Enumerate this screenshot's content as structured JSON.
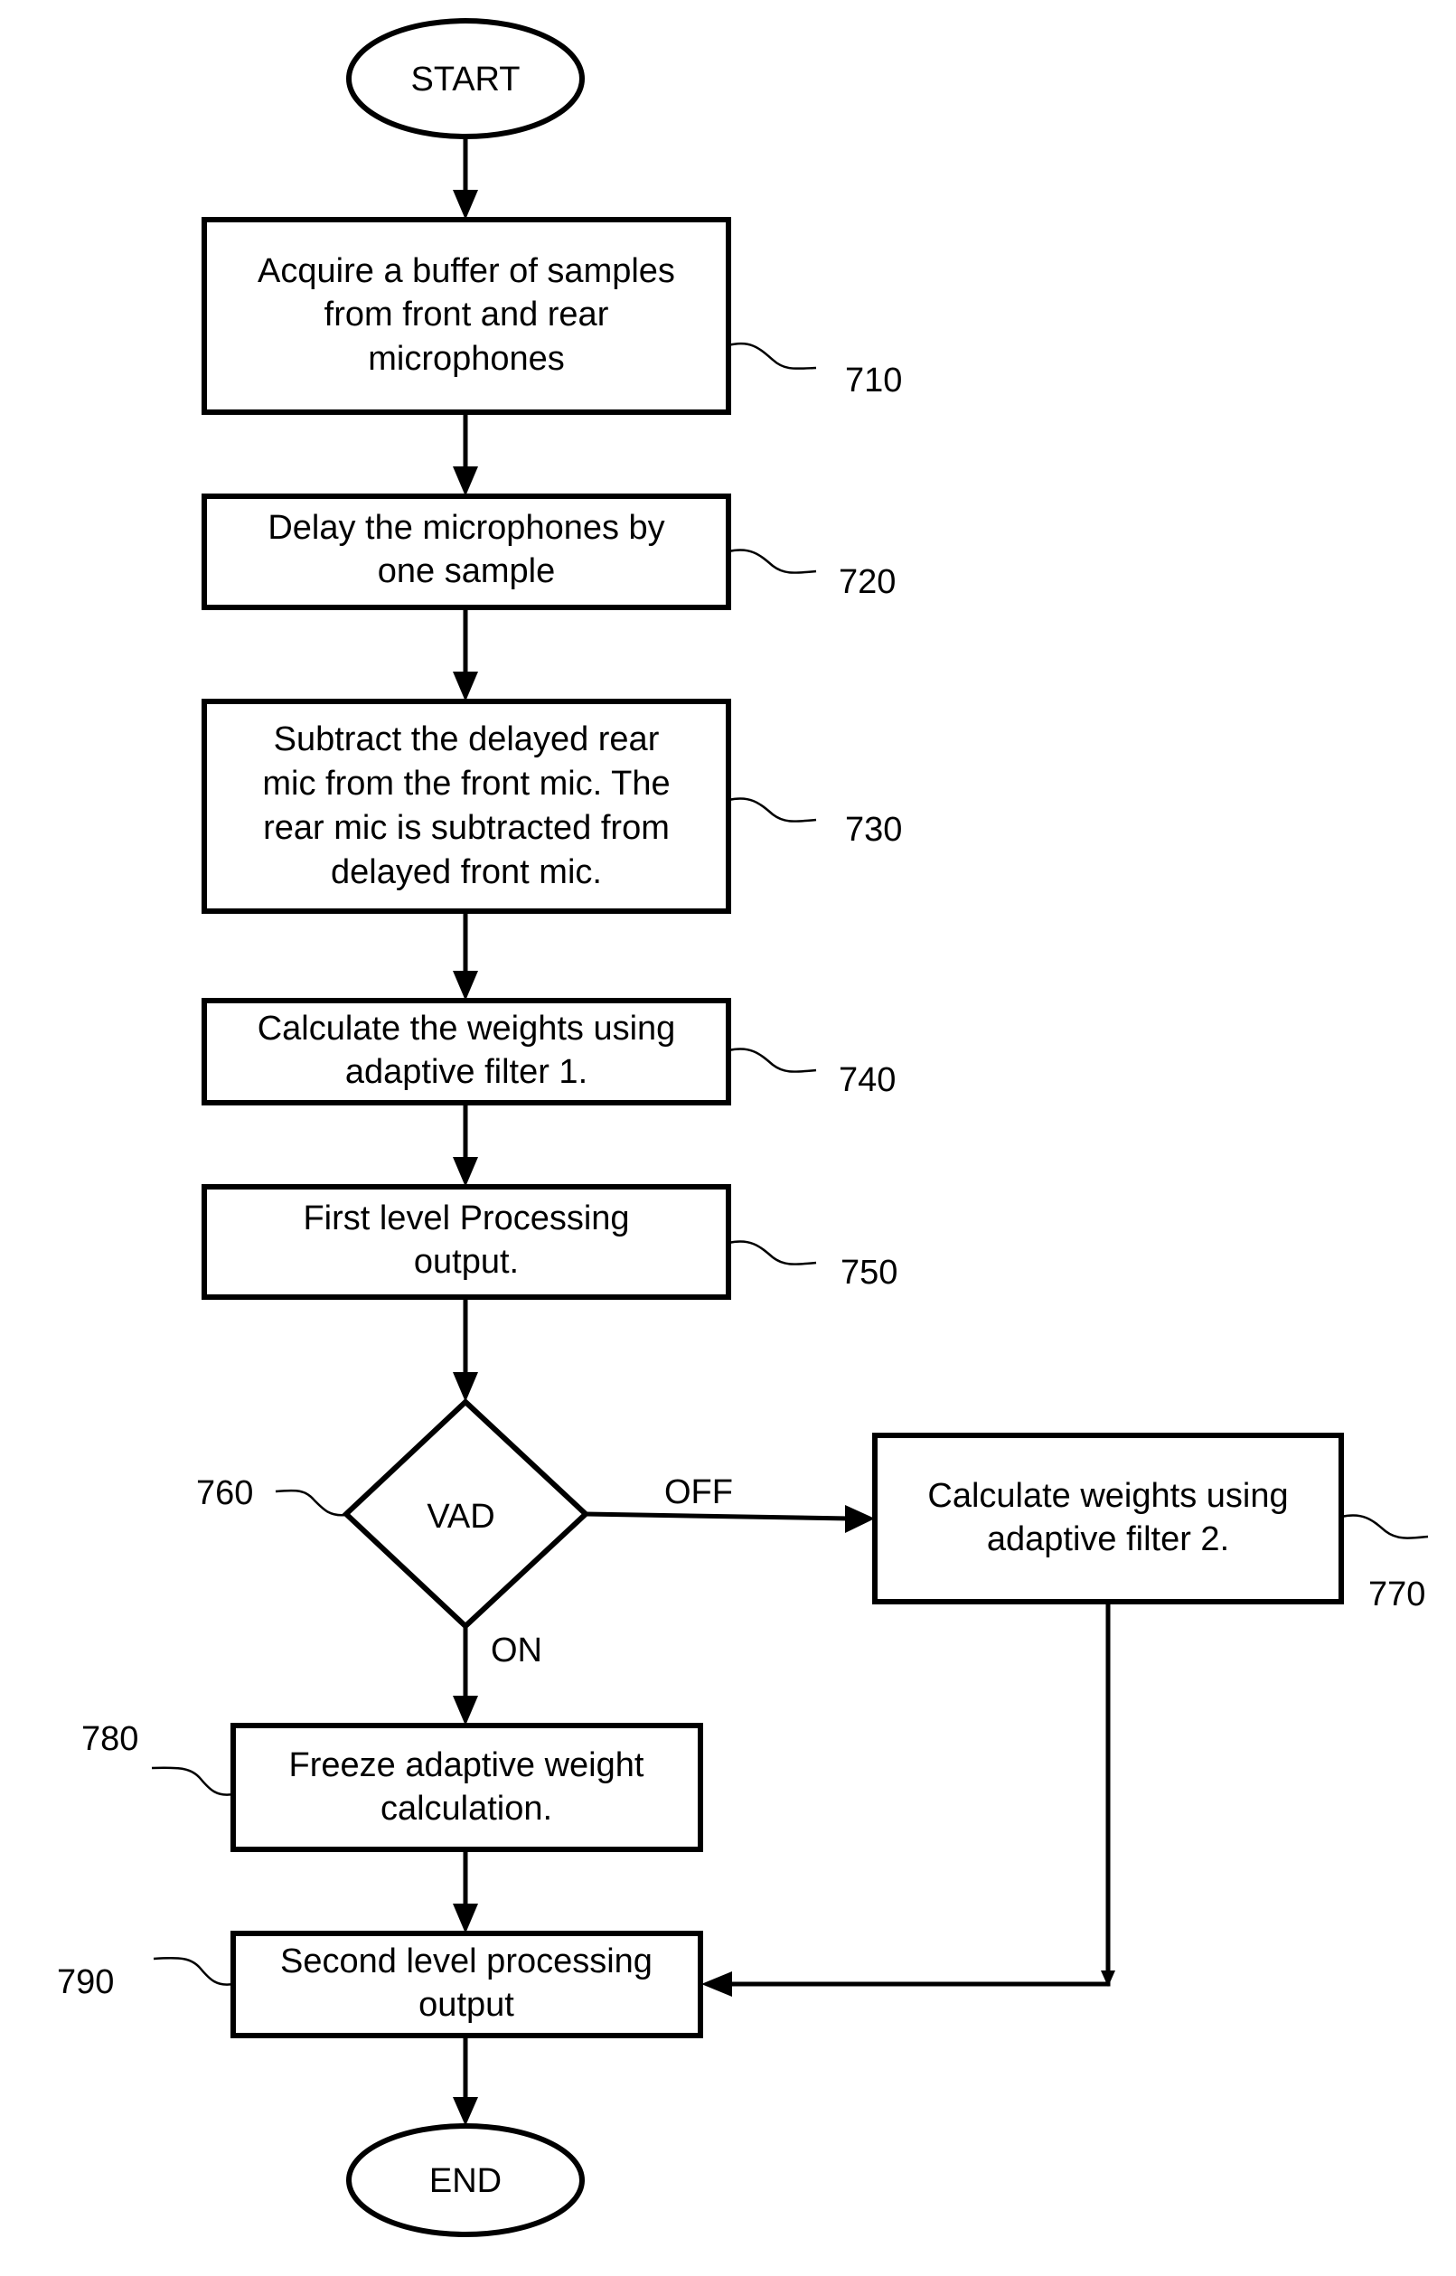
{
  "figure": {
    "start": {
      "label": "START"
    },
    "end": {
      "label": "END"
    },
    "steps": [
      {
        "ref": "710",
        "lines": [
          "Acquire a buffer of samples",
          "from front and rear",
          "microphones"
        ]
      },
      {
        "ref": "720",
        "lines": [
          "Delay the microphones by",
          "one sample"
        ]
      },
      {
        "ref": "730",
        "lines": [
          "Subtract the delayed rear",
          "mic  from the front mic. The",
          "rear mic is subtracted from",
          "delayed front mic."
        ]
      },
      {
        "ref": "740",
        "lines": [
          "Calculate the weights using",
          "adaptive filter 1."
        ]
      },
      {
        "ref": "750",
        "lines": [
          "First level Processing",
          "output."
        ]
      },
      {
        "ref": "760",
        "lines": [
          "VAD"
        ]
      },
      {
        "ref": "770",
        "lines": [
          "Calculate weights using",
          "adaptive filter 2."
        ]
      },
      {
        "ref": "780",
        "lines": [
          "Freeze adaptive weight",
          "calculation."
        ]
      },
      {
        "ref": "790",
        "lines": [
          "Second level processing",
          "output"
        ]
      }
    ],
    "branches": {
      "off": "OFF",
      "on": "ON"
    },
    "connections": [
      [
        "START",
        "710"
      ],
      [
        "710",
        "720"
      ],
      [
        "720",
        "730"
      ],
      [
        "730",
        "740"
      ],
      [
        "740",
        "750"
      ],
      [
        "750",
        "760"
      ],
      [
        "760",
        "770",
        "OFF"
      ],
      [
        "760",
        "780",
        "ON"
      ],
      [
        "780",
        "790"
      ],
      [
        "770",
        "790"
      ],
      [
        "790",
        "END"
      ]
    ]
  }
}
